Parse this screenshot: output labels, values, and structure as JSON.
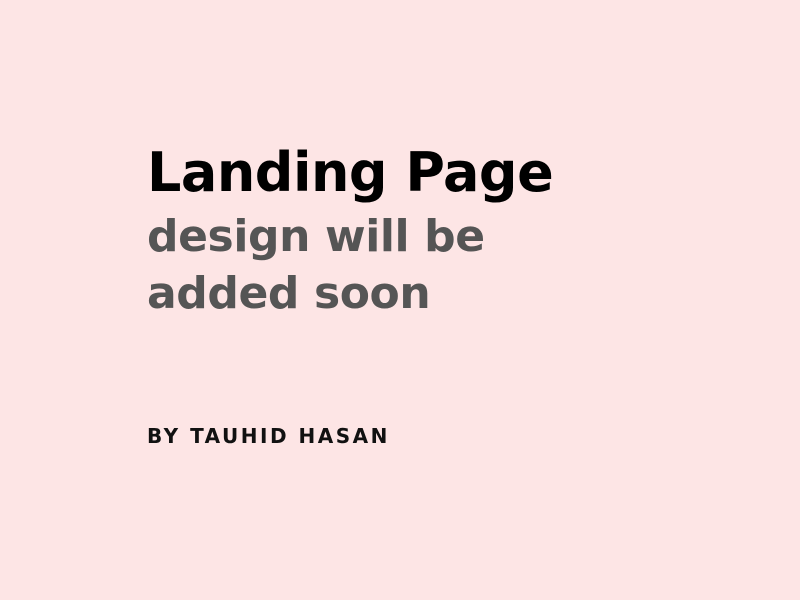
{
  "headline": {
    "title": "Landing Page",
    "subtitle": "design will be added soon"
  },
  "byline": "BY TAUHID HASAN",
  "colors": {
    "background": "#fde5e5",
    "title": "#000000",
    "subtitle": "#555555",
    "byline": "#111111"
  }
}
